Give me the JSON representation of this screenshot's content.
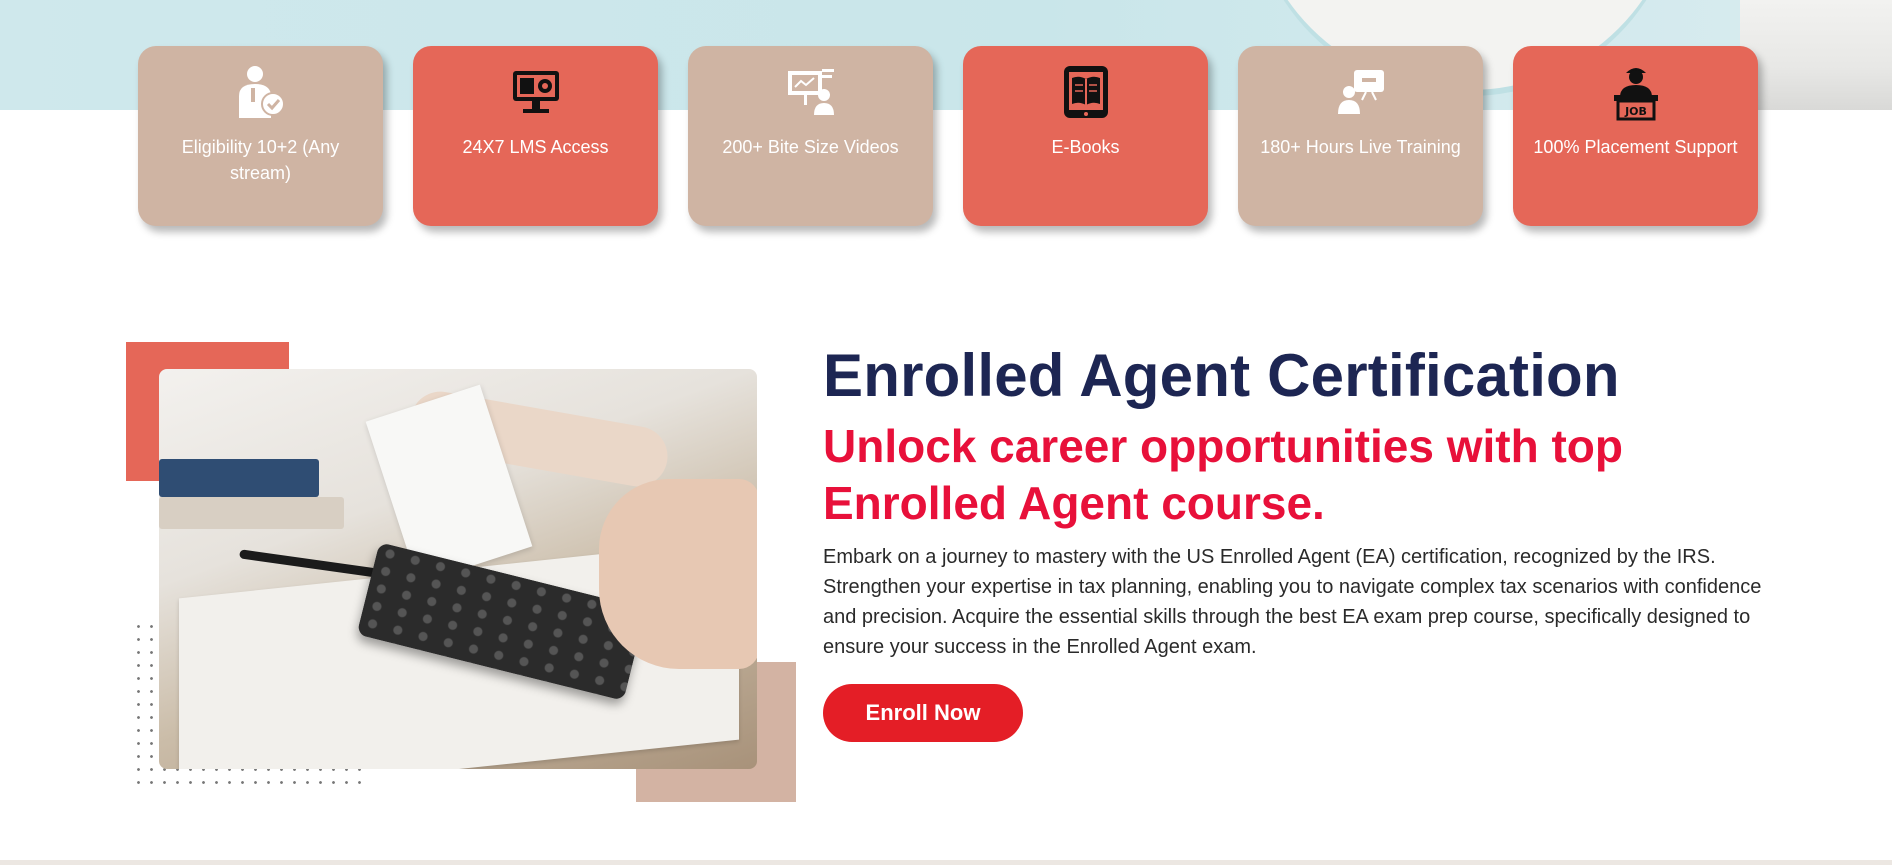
{
  "features": [
    {
      "label": "Eligibility 10+2 (Any stream)",
      "icon": "eligibility-person-check-icon",
      "color": "#cfb4a3"
    },
    {
      "label": "24X7 LMS Access",
      "icon": "lms-monitor-icon",
      "color": "#e56758"
    },
    {
      "label": "200+ Bite Size Videos",
      "icon": "video-presentation-icon",
      "color": "#cfb4a3"
    },
    {
      "label": "E-Books",
      "icon": "ebook-tablet-icon",
      "color": "#e56758"
    },
    {
      "label": "180+ Hours Live Training",
      "icon": "live-training-icon",
      "color": "#cfb4a3"
    },
    {
      "label": "100% Placement Support",
      "icon": "job-placement-icon",
      "color": "#e56758"
    }
  ],
  "course": {
    "title": "Enrolled Agent Certification",
    "subtitle": "Unlock career opportunities with top Enrolled Agent course.",
    "description": "Embark on a journey to mastery with the US Enrolled Agent (EA) certification, recognized by the IRS. Strengthen your expertise in tax planning, enabling you to navigate complex tax scenarios with confidence and precision. Acquire the essential skills through the best EA exam prep course, specifically designed to ensure your success in the Enrolled Agent exam.",
    "enroll_label": "Enroll Now"
  },
  "job_badge_text": "JOB",
  "colors": {
    "navy": "#1d2653",
    "red": "#e8103a",
    "button": "#e41e26",
    "coral": "#e56758",
    "beige": "#cfb4a3"
  }
}
